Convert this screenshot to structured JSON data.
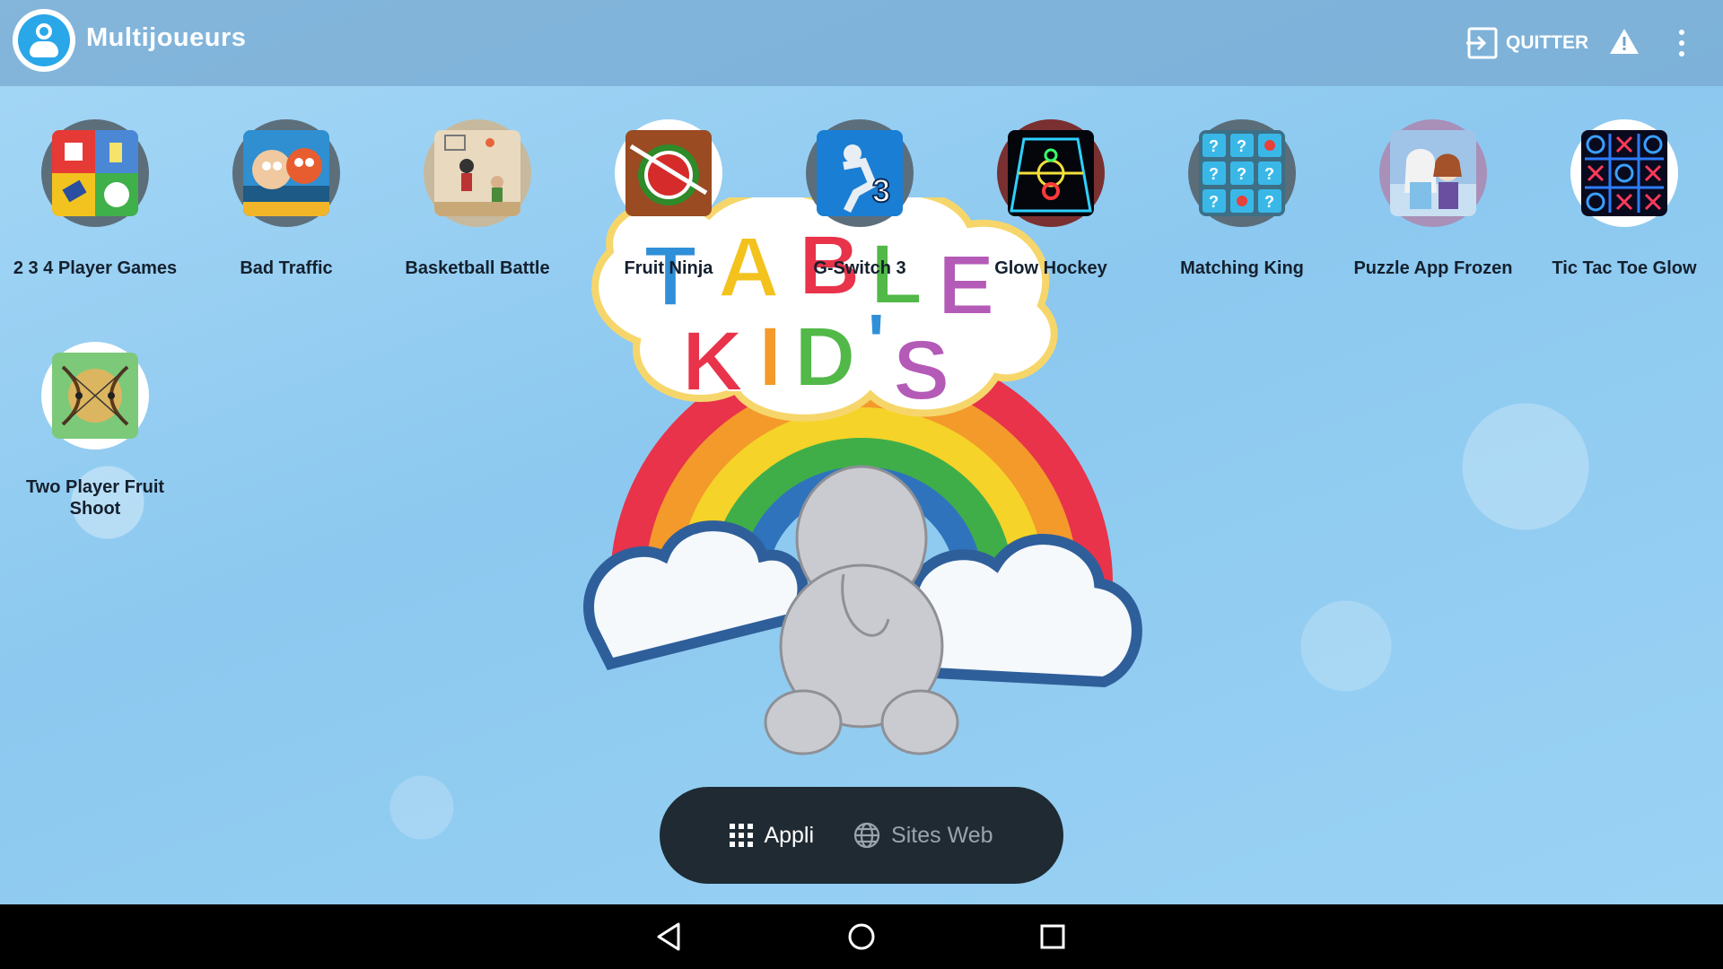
{
  "header": {
    "title": "Multijoueurs",
    "quit_label": "QUITTER"
  },
  "apps": [
    {
      "label": "2 3 4 Player Games",
      "icon": "multiplayer-games-icon"
    },
    {
      "label": "Bad Traffic",
      "icon": "bad-traffic-icon"
    },
    {
      "label": "Basketball Battle",
      "icon": "basketball-battle-icon"
    },
    {
      "label": "Fruit Ninja",
      "icon": "fruit-ninja-icon"
    },
    {
      "label": "G-Switch 3",
      "icon": "g-switch-icon"
    },
    {
      "label": "Glow Hockey",
      "icon": "glow-hockey-icon"
    },
    {
      "label": "Matching King",
      "icon": "matching-king-icon"
    },
    {
      "label": "Puzzle App Frozen",
      "icon": "frozen-puzzle-icon"
    },
    {
      "label": "Tic Tac Toe Glow",
      "icon": "tic-tac-toe-icon"
    },
    {
      "label": "Two Player Fruit Shoot",
      "icon": "fruit-shoot-icon"
    }
  ],
  "bottom_tabs": [
    {
      "label": "Appli",
      "active": true
    },
    {
      "label": "Sites Web",
      "active": false
    }
  ],
  "colors": {
    "accent": "#29a7e8",
    "bottom_bar": "#1f2a33",
    "background": "#9ad2f4"
  }
}
